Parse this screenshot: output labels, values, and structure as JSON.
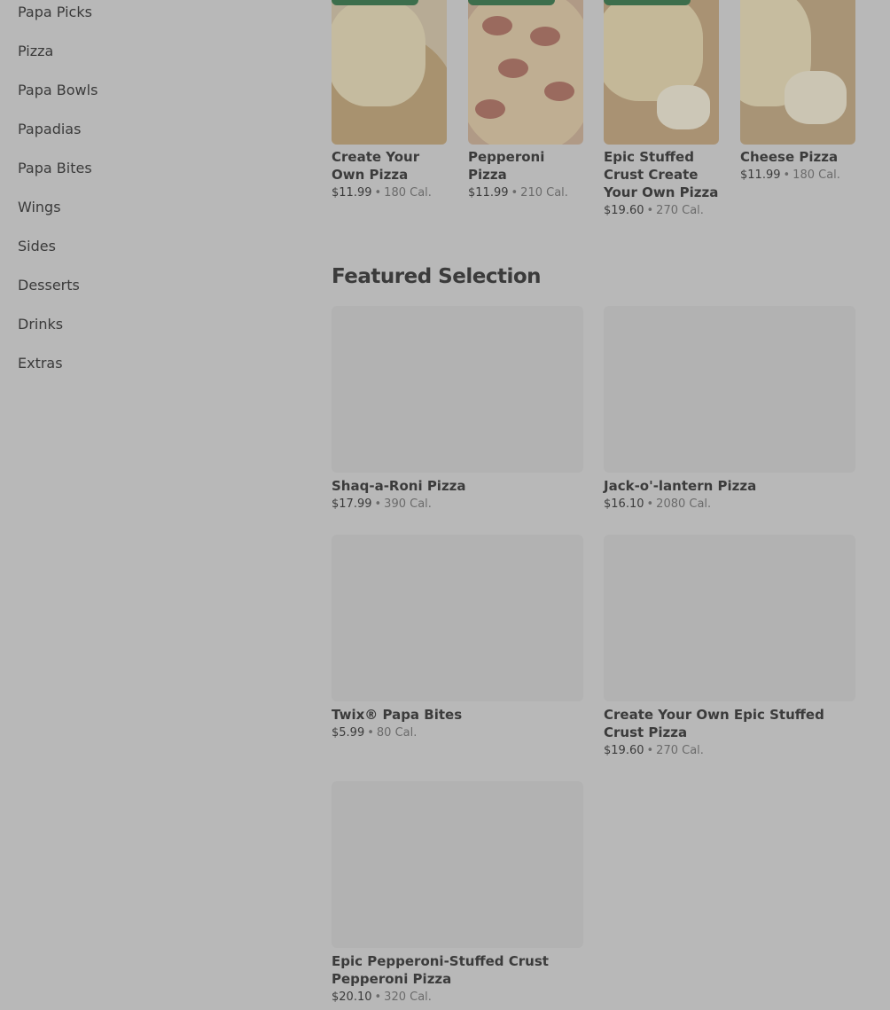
{
  "sidebar": {
    "items": [
      {
        "label": "Papa Picks"
      },
      {
        "label": "Pizza"
      },
      {
        "label": "Papa Bowls"
      },
      {
        "label": "Papadias"
      },
      {
        "label": "Papa Bites"
      },
      {
        "label": "Wings"
      },
      {
        "label": "Sides"
      },
      {
        "label": "Desserts"
      },
      {
        "label": "Drinks"
      },
      {
        "label": "Extras"
      }
    ]
  },
  "top_products": [
    {
      "title": "Create Your Own Pizza",
      "price": "$11.99",
      "calories": "180 Cal."
    },
    {
      "title": "Pepperoni Pizza",
      "price": "$11.99",
      "calories": "210 Cal."
    },
    {
      "title": "Epic Stuffed Crust Create Your Own Pizza",
      "price": "$19.60",
      "calories": "270 Cal."
    },
    {
      "title": "Cheese Pizza",
      "price": "$11.99",
      "calories": "180 Cal."
    }
  ],
  "featured": {
    "heading": "Featured Selection",
    "items": [
      {
        "title": "Shaq-a-Roni Pizza",
        "price": "$17.99",
        "calories": "390 Cal."
      },
      {
        "title": "Jack-o'-lantern Pizza",
        "price": "$16.10",
        "calories": "2080 Cal."
      },
      {
        "title": "Twix® Papa Bites",
        "price": "$5.99",
        "calories": "80 Cal."
      },
      {
        "title": "Create Your Own Epic Stuffed Crust Pizza",
        "price": "$19.60",
        "calories": "270 Cal."
      },
      {
        "title": "Epic Pepperoni-Stuffed Crust Pepperoni Pizza",
        "price": "$20.10",
        "calories": "320 Cal."
      }
    ]
  },
  "meta_separator": "•"
}
